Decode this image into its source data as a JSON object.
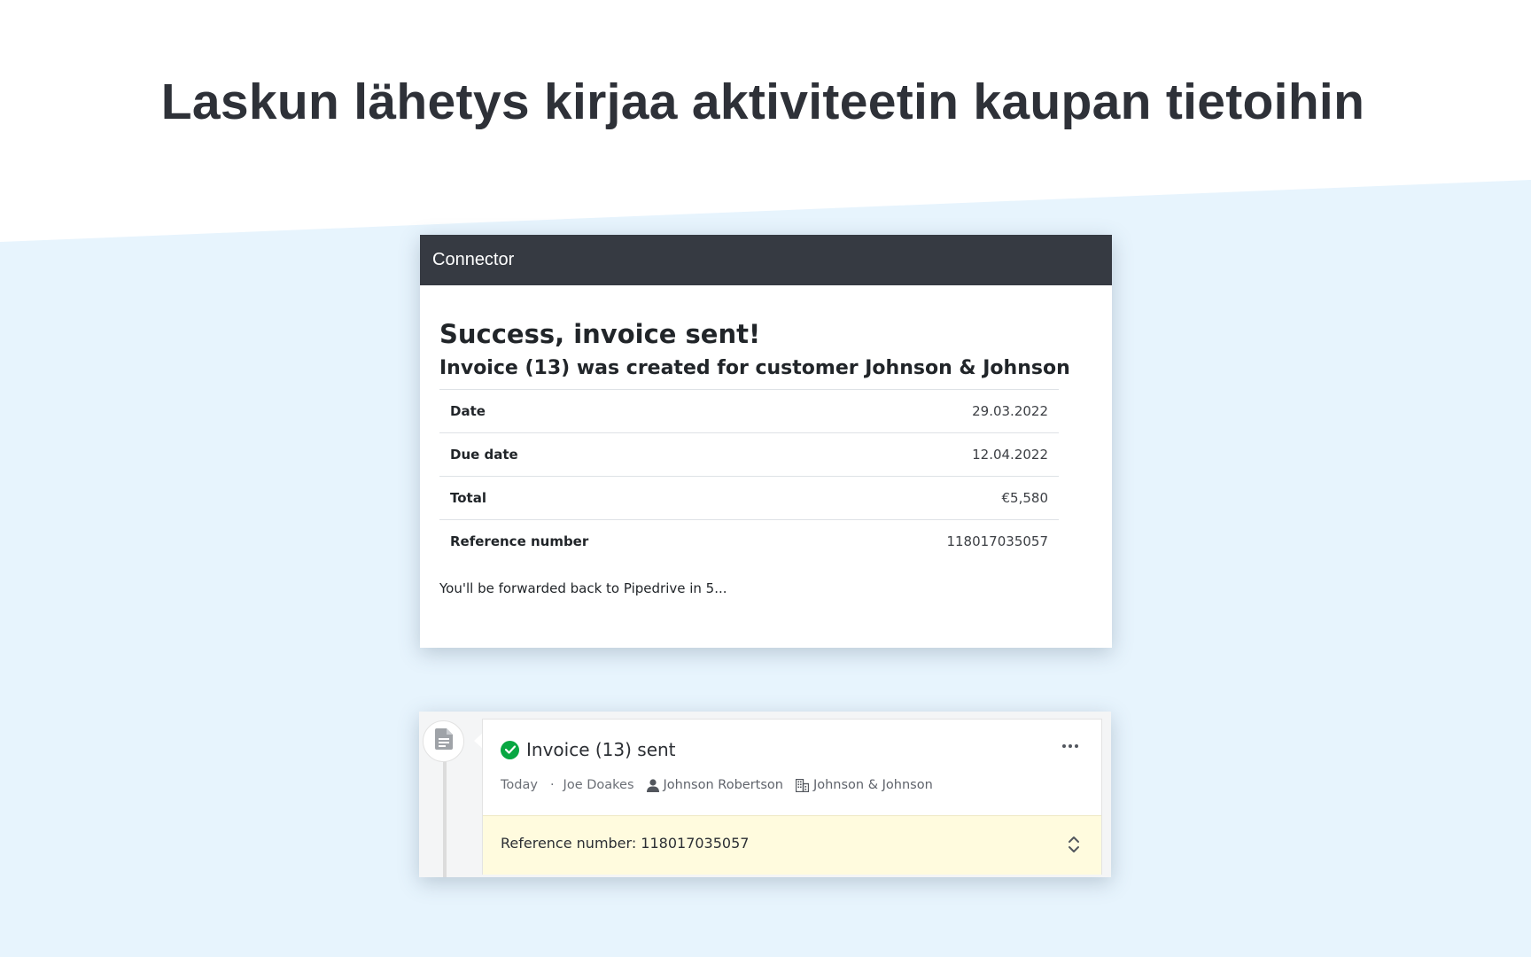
{
  "page": {
    "headline": "Laskun lähetys kirjaa aktiviteetin kaupan tietoihin",
    "colors": {
      "background_band": "#e7f4fd",
      "header_dark": "#363a42",
      "success_green": "#08a742",
      "note_yellow": "#fffbde"
    }
  },
  "connector": {
    "header_title": "Connector",
    "success_title": "Success, invoice sent!",
    "subtitle": "Invoice (13) was created for customer Johnson & Johnson",
    "details": [
      {
        "label": "Date",
        "value": "29.03.2022"
      },
      {
        "label": "Due date",
        "value": "12.04.2022"
      },
      {
        "label": "Total",
        "value": "€5,580"
      },
      {
        "label": "Reference number",
        "value": "118017035057"
      }
    ],
    "forward_note": "You'll be forwarded back to Pipedrive in 5..."
  },
  "activity": {
    "icon": "document-icon",
    "status_icon": "check-circle-icon",
    "title": "Invoice (13) sent",
    "when": "Today",
    "separator": "·",
    "owner": "Joe Doakes",
    "person": "Johnson Robertson",
    "organization": "Johnson & Johnson",
    "note": "Reference number: 118017035057"
  }
}
